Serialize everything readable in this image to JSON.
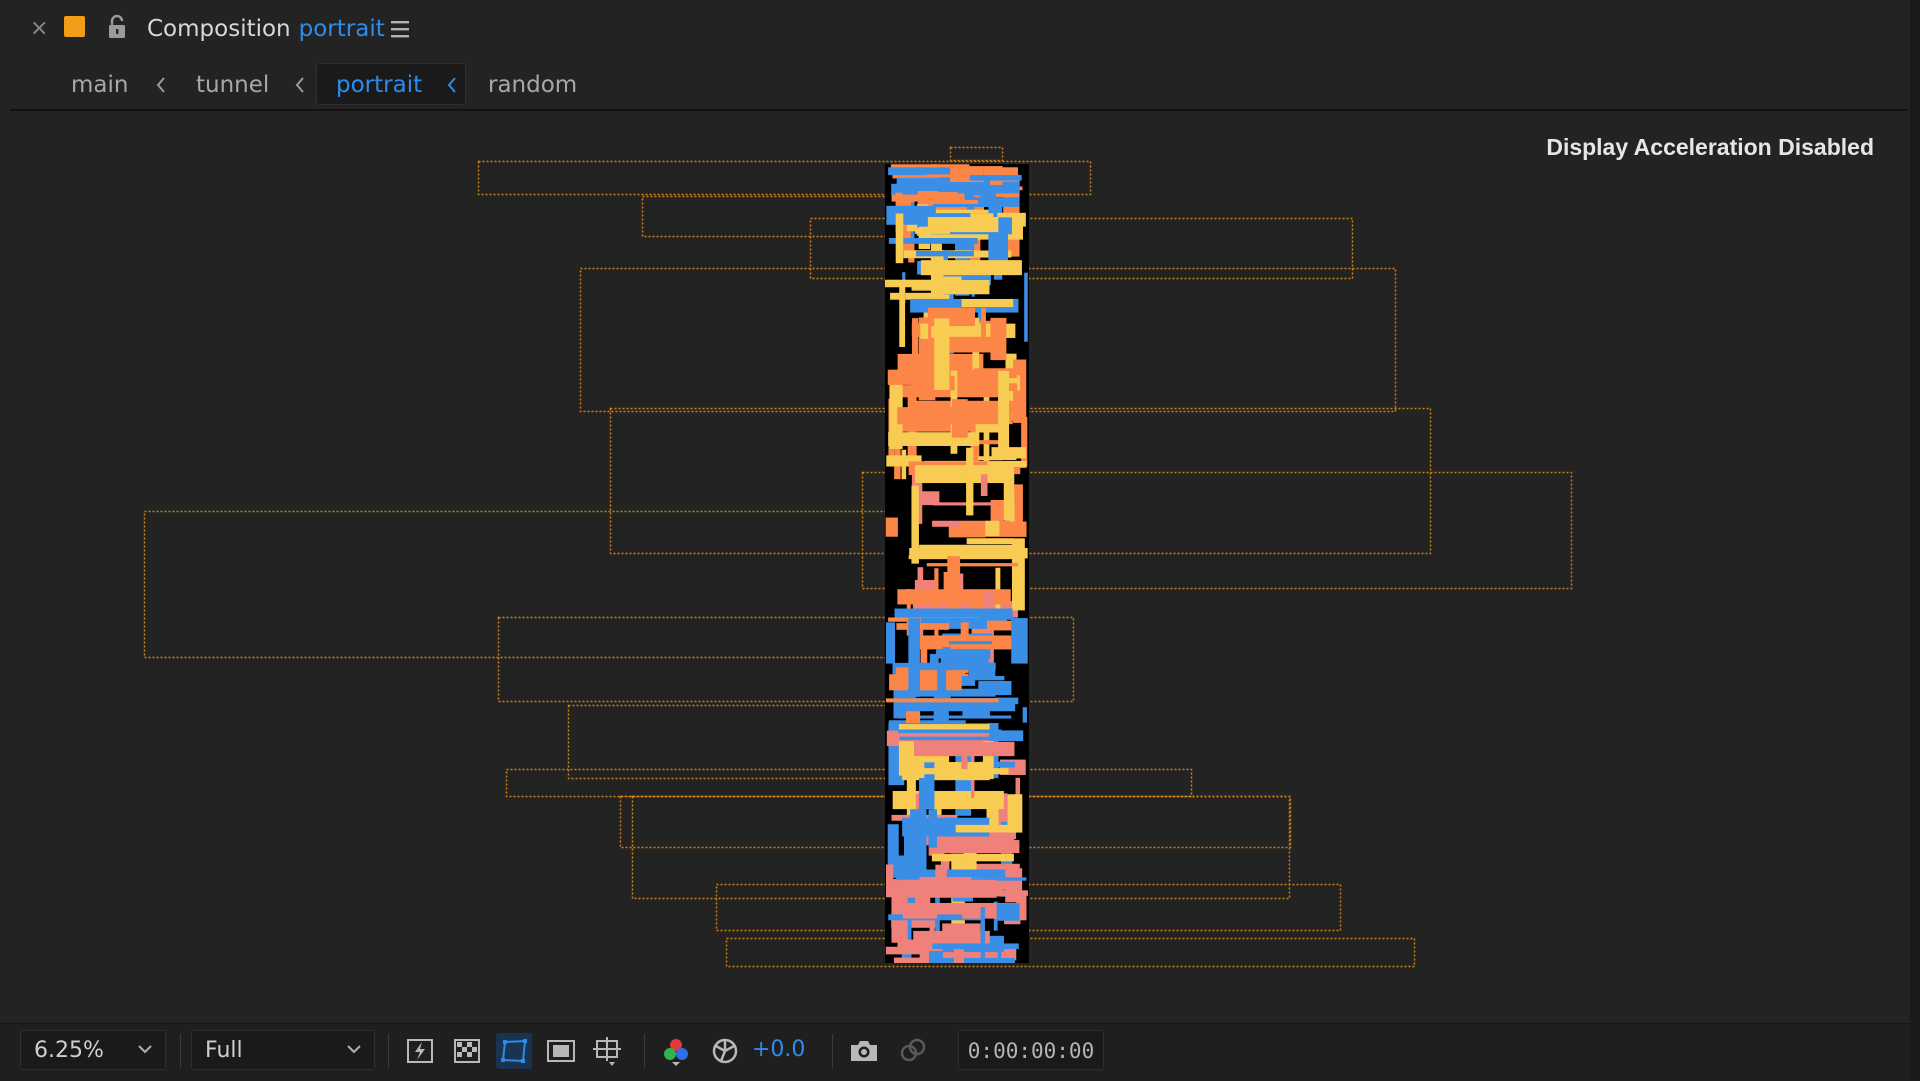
{
  "panel": {
    "close_glyph": "×",
    "label_color": "#f29d15",
    "title_prefix": "Composition",
    "comp_name": "portrait",
    "icons": {
      "close": "close-icon",
      "lock": "lock-icon",
      "menu": "hamburger-menu-icon"
    }
  },
  "breadcrumbs": [
    {
      "label": "main"
    },
    {
      "label": "tunnel"
    },
    {
      "label": "portrait",
      "active": true
    },
    {
      "label": "random"
    }
  ],
  "viewer": {
    "status": "Display Acceleration Disabled",
    "background": "#232323",
    "layer_outline_color": "#e58c12",
    "palette": {
      "orange": "#fc8647",
      "blue": "#3a8ee6",
      "yellow": "#f8cb52",
      "salmon": "#f0807a",
      "black": "#000000"
    }
  },
  "toolbar": {
    "zoom": "6.25%",
    "resolution": "Full",
    "exposure": "+0.0",
    "timecode": "0:00:00:00",
    "accent": "#2d8ceb",
    "icons": [
      "always-preview-icon",
      "transparency-grid-icon",
      "mask-path-visibility-icon",
      "region-of-interest-icon",
      "guides-grid-icon",
      "color-channels-icon",
      "reset-exposure-icon",
      "snapshot-camera-icon",
      "show-snapshot-icon"
    ]
  }
}
